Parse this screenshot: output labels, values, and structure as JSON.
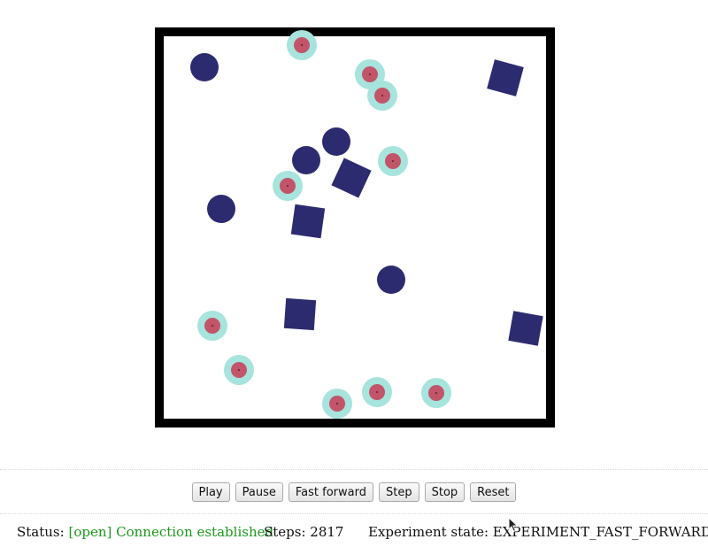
{
  "controls": {
    "play_label": "Play",
    "pause_label": "Pause",
    "fast_forward_label": "Fast forward",
    "step_label": "Step",
    "stop_label": "Stop",
    "reset_label": "Reset"
  },
  "status": {
    "status_label": "Status:",
    "connection": "[open] Connection established",
    "steps_text": "Steps: 2817",
    "experiment_text": "Experiment state: EXPERIMENT_FAST_FORWARDING"
  },
  "colors": {
    "arena_wall": "#000000",
    "obstacle": "#2d2b70",
    "robot_body": "#c25569",
    "robot_halo": "#a6e4dd",
    "status_ok": "#1a9a1a"
  }
}
